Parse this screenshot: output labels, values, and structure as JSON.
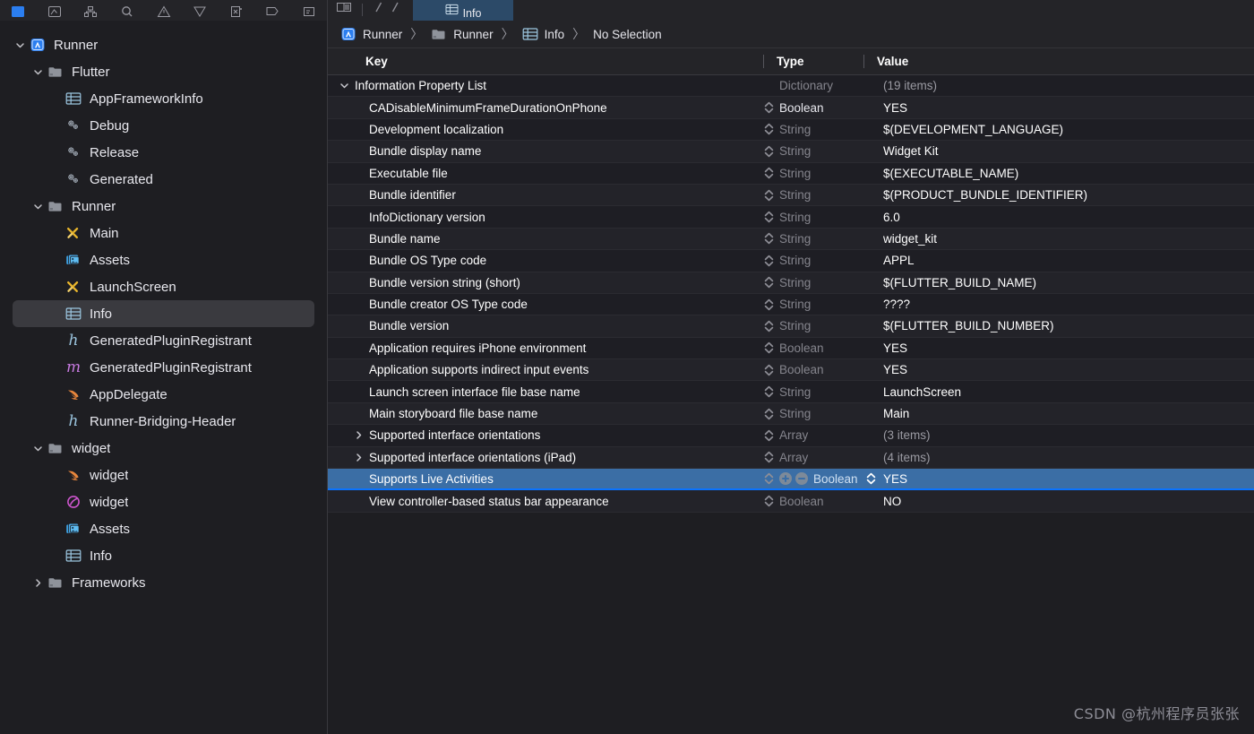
{
  "toolbar": {
    "icons": [
      "project-navigator-icon",
      "source-control-icon",
      "search-icon",
      "issue-navigator-icon",
      "test-navigator-icon",
      "debug-navigator-icon",
      "breakpoint-navigator-icon",
      "report-navigator-icon"
    ],
    "editor_layout_icon": "editor-options-icon",
    "back_icon": "back-chevron-icon",
    "forward_icon": "forward-chevron-icon",
    "active_tab": {
      "label": "Info",
      "icon": "plist-icon"
    }
  },
  "sidebar": {
    "items": [
      {
        "label": "Runner",
        "icon": "xcode-project-icon",
        "indent": 0,
        "disclosure": "open",
        "selected": false
      },
      {
        "label": "Flutter",
        "icon": "folder-icon",
        "indent": 1,
        "disclosure": "open",
        "selected": false
      },
      {
        "label": "AppFrameworkInfo",
        "icon": "plist-icon",
        "indent": 2,
        "disclosure": "none",
        "selected": false
      },
      {
        "label": "Debug",
        "icon": "xcconfig-icon",
        "indent": 2,
        "disclosure": "none",
        "selected": false
      },
      {
        "label": "Release",
        "icon": "xcconfig-icon",
        "indent": 2,
        "disclosure": "none",
        "selected": false
      },
      {
        "label": "Generated",
        "icon": "xcconfig-icon",
        "indent": 2,
        "disclosure": "none",
        "selected": false
      },
      {
        "label": "Runner",
        "icon": "folder-icon",
        "indent": 1,
        "disclosure": "open",
        "selected": false
      },
      {
        "label": "Main",
        "icon": "storyboard-icon",
        "indent": 2,
        "disclosure": "none",
        "selected": false
      },
      {
        "label": "Assets",
        "icon": "assets-catalog-icon",
        "indent": 2,
        "disclosure": "none",
        "selected": false
      },
      {
        "label": "LaunchScreen",
        "icon": "storyboard-icon",
        "indent": 2,
        "disclosure": "none",
        "selected": false
      },
      {
        "label": "Info",
        "icon": "plist-icon",
        "indent": 2,
        "disclosure": "none",
        "selected": true
      },
      {
        "label": "GeneratedPluginRegistrant",
        "icon": "header-file-icon",
        "indent": 2,
        "disclosure": "none",
        "selected": false
      },
      {
        "label": "GeneratedPluginRegistrant",
        "icon": "objc-file-icon",
        "indent": 2,
        "disclosure": "none",
        "selected": false
      },
      {
        "label": "AppDelegate",
        "icon": "swift-file-icon",
        "indent": 2,
        "disclosure": "none",
        "selected": false
      },
      {
        "label": "Runner-Bridging-Header",
        "icon": "header-file-icon",
        "indent": 2,
        "disclosure": "none",
        "selected": false
      },
      {
        "label": "widget",
        "icon": "folder-icon",
        "indent": 1,
        "disclosure": "open",
        "selected": false
      },
      {
        "label": "widget",
        "icon": "swift-file-icon",
        "indent": 2,
        "disclosure": "none",
        "selected": false
      },
      {
        "label": "widget",
        "icon": "intentdefinition-icon",
        "indent": 2,
        "disclosure": "none",
        "selected": false
      },
      {
        "label": "Assets",
        "icon": "assets-catalog-icon",
        "indent": 2,
        "disclosure": "none",
        "selected": false
      },
      {
        "label": "Info",
        "icon": "plist-icon",
        "indent": 2,
        "disclosure": "none",
        "selected": false
      },
      {
        "label": "Frameworks",
        "icon": "folder-icon",
        "indent": 1,
        "disclosure": "closed",
        "selected": false
      }
    ]
  },
  "breadcrumb": {
    "items": [
      {
        "label": "Runner",
        "icon": "xcode-project-icon"
      },
      {
        "label": "Runner",
        "icon": "folder-icon"
      },
      {
        "label": "Info",
        "icon": "plist-icon"
      },
      {
        "label": "No Selection",
        "icon": "none"
      }
    ],
    "separator": "〉"
  },
  "table": {
    "columns": [
      "Key",
      "Type",
      "Value"
    ],
    "rows": [
      {
        "key": "Information Property List",
        "type": "Dictionary",
        "value": "(19 items)",
        "disclosure": "open",
        "indent": 0,
        "type_dim": true,
        "value_dim": true,
        "selected": false
      },
      {
        "key": "CADisableMinimumFrameDurationOnPhone",
        "type": "Boolean",
        "value": "YES",
        "disclosure": "none",
        "indent": 1,
        "type_dim": false,
        "value_dim": false,
        "selected": false
      },
      {
        "key": "Development localization",
        "type": "String",
        "value": "$(DEVELOPMENT_LANGUAGE)",
        "disclosure": "none",
        "indent": 1,
        "type_dim": true,
        "value_dim": false,
        "selected": false
      },
      {
        "key": "Bundle display name",
        "type": "String",
        "value": "Widget Kit",
        "disclosure": "none",
        "indent": 1,
        "type_dim": true,
        "value_dim": false,
        "selected": false
      },
      {
        "key": "Executable file",
        "type": "String",
        "value": "$(EXECUTABLE_NAME)",
        "disclosure": "none",
        "indent": 1,
        "type_dim": true,
        "value_dim": false,
        "selected": false
      },
      {
        "key": "Bundle identifier",
        "type": "String",
        "value": "$(PRODUCT_BUNDLE_IDENTIFIER)",
        "disclosure": "none",
        "indent": 1,
        "type_dim": true,
        "value_dim": false,
        "selected": false
      },
      {
        "key": "InfoDictionary version",
        "type": "String",
        "value": "6.0",
        "disclosure": "none",
        "indent": 1,
        "type_dim": true,
        "value_dim": false,
        "selected": false
      },
      {
        "key": "Bundle name",
        "type": "String",
        "value": "widget_kit",
        "disclosure": "none",
        "indent": 1,
        "type_dim": true,
        "value_dim": false,
        "selected": false
      },
      {
        "key": "Bundle OS Type code",
        "type": "String",
        "value": "APPL",
        "disclosure": "none",
        "indent": 1,
        "type_dim": true,
        "value_dim": false,
        "selected": false
      },
      {
        "key": "Bundle version string (short)",
        "type": "String",
        "value": "$(FLUTTER_BUILD_NAME)",
        "disclosure": "none",
        "indent": 1,
        "type_dim": true,
        "value_dim": false,
        "selected": false
      },
      {
        "key": "Bundle creator OS Type code",
        "type": "String",
        "value": "????",
        "disclosure": "none",
        "indent": 1,
        "type_dim": true,
        "value_dim": false,
        "selected": false
      },
      {
        "key": "Bundle version",
        "type": "String",
        "value": "$(FLUTTER_BUILD_NUMBER)",
        "disclosure": "none",
        "indent": 1,
        "type_dim": true,
        "value_dim": false,
        "selected": false
      },
      {
        "key": "Application requires iPhone environment",
        "type": "Boolean",
        "value": "YES",
        "disclosure": "none",
        "indent": 1,
        "type_dim": true,
        "value_dim": false,
        "selected": false
      },
      {
        "key": "Application supports indirect input events",
        "type": "Boolean",
        "value": "YES",
        "disclosure": "none",
        "indent": 1,
        "type_dim": true,
        "value_dim": false,
        "selected": false
      },
      {
        "key": "Launch screen interface file base name",
        "type": "String",
        "value": "LaunchScreen",
        "disclosure": "none",
        "indent": 1,
        "type_dim": true,
        "value_dim": false,
        "selected": false
      },
      {
        "key": "Main storyboard file base name",
        "type": "String",
        "value": "Main",
        "disclosure": "none",
        "indent": 1,
        "type_dim": true,
        "value_dim": false,
        "selected": false
      },
      {
        "key": "Supported interface orientations",
        "type": "Array",
        "value": "(3 items)",
        "disclosure": "closed",
        "indent": 1,
        "type_dim": true,
        "value_dim": true,
        "selected": false
      },
      {
        "key": "Supported interface orientations (iPad)",
        "type": "Array",
        "value": "(4 items)",
        "disclosure": "closed",
        "indent": 1,
        "type_dim": true,
        "value_dim": true,
        "selected": false
      },
      {
        "key": "Supports Live Activities",
        "type": "Boolean",
        "value": "YES",
        "disclosure": "none",
        "indent": 1,
        "type_dim": true,
        "value_dim": false,
        "selected": true
      },
      {
        "key": "View controller-based status bar appearance",
        "type": "Boolean",
        "value": "NO",
        "disclosure": "none",
        "indent": 1,
        "type_dim": true,
        "value_dim": false,
        "selected": false
      }
    ]
  },
  "watermark": {
    "text": "CSDN @杭州程序员张张"
  },
  "colors": {
    "accent": "#0a73ff",
    "selection": "#3b6ea5",
    "background": "#1e1e22",
    "chrome": "#242428",
    "swift_orange": "#e8863c",
    "storyboard_yellow": "#e8b52c",
    "plist_blue": "#9cc6e0",
    "assets_blue": "#3c9ede",
    "objc_purple": "#c77ae0",
    "intent_magenta": "#cc55cc"
  }
}
